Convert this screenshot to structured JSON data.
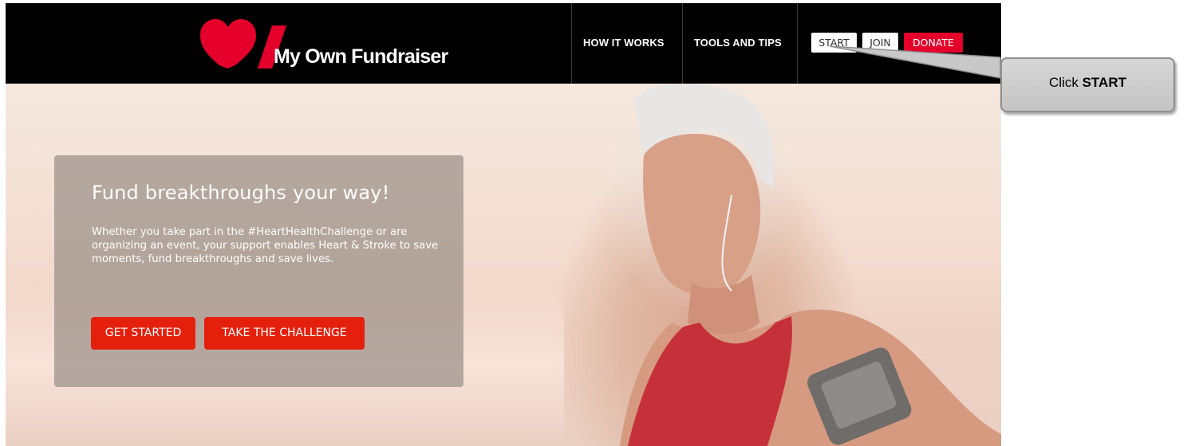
{
  "brand": {
    "name": "My Own Fundraiser",
    "accent": "#e4002b"
  },
  "nav": {
    "links": [
      "HOW IT WORKS",
      "TOOLS AND TIPS"
    ],
    "start_label": "START",
    "join_label": "JOIN",
    "donate_label": "DONATE"
  },
  "hero": {
    "title": "Fund breakthroughs your way!",
    "body": "Whether you take part in the #HeartHealthChallenge or are organizing an event, your support enables Heart & Stroke to save moments, fund breakthroughs and save lives.",
    "cta_primary": "GET STARTED",
    "cta_secondary": "TAKE THE CHALLENGE",
    "cta_color": "#e4200d"
  },
  "callout": {
    "prefix": "Click ",
    "target": "START"
  }
}
